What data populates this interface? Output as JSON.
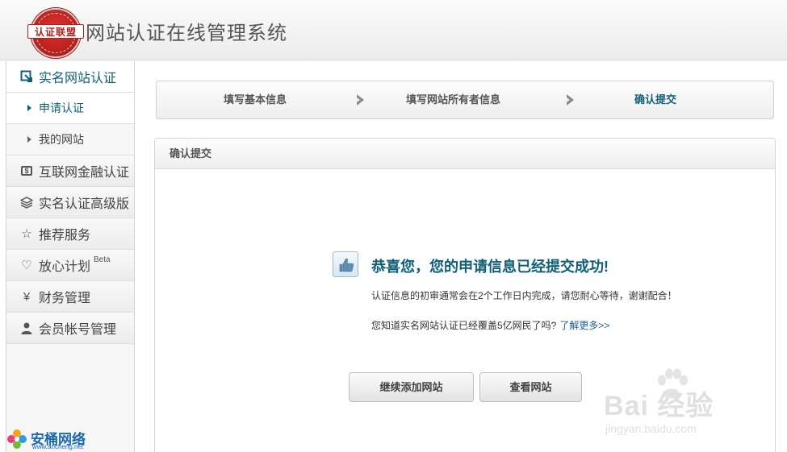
{
  "header": {
    "logo_text": "认证联盟",
    "title": "网站认证在线管理系统"
  },
  "sidebar": {
    "items": [
      {
        "label": "实名网站认证",
        "icon": "verify-icon",
        "active": true
      },
      {
        "label": "申请认证",
        "sub": true,
        "active": true
      },
      {
        "label": "我的网站",
        "sub": true
      },
      {
        "label": "互联网金融认证",
        "icon": "finance-cert-icon"
      },
      {
        "label": "实名认证高级版",
        "icon": "layers-icon"
      },
      {
        "label": "推荐服务",
        "icon": "star-icon"
      },
      {
        "label": "放心计划",
        "icon": "heart-icon",
        "sup": "Beta"
      },
      {
        "label": "财务管理",
        "icon": "yen-icon"
      },
      {
        "label": "会员帐号管理",
        "icon": "user-icon"
      }
    ]
  },
  "steps": [
    {
      "label": "填写基本信息"
    },
    {
      "label": "填写网站所有者信息"
    },
    {
      "label": "确认提交",
      "current": true
    }
  ],
  "panel": {
    "title": "确认提交",
    "success_title": "恭喜您，您的申请信息已经提交成功!",
    "message_1": "认证信息的初审通常会在2个工作日内完成，请您耐心等待，谢谢配合！",
    "message_2": "您知道实名网站认证已经覆盖5亿网民了吗?",
    "learn_more": "了解更多>>",
    "buttons": {
      "continue": "继续添加网站",
      "view": "查看网站"
    }
  },
  "watermarks": {
    "baidu_text": "Bai 经验",
    "baidu_url": "jingyan.baidu.com",
    "anxin_name": "安桶网络",
    "anxin_url": "www.ancheng.net"
  },
  "colors": {
    "accent": "#0e5f77",
    "link": "#1a5f9a",
    "logo_red": "#b51f1c"
  }
}
